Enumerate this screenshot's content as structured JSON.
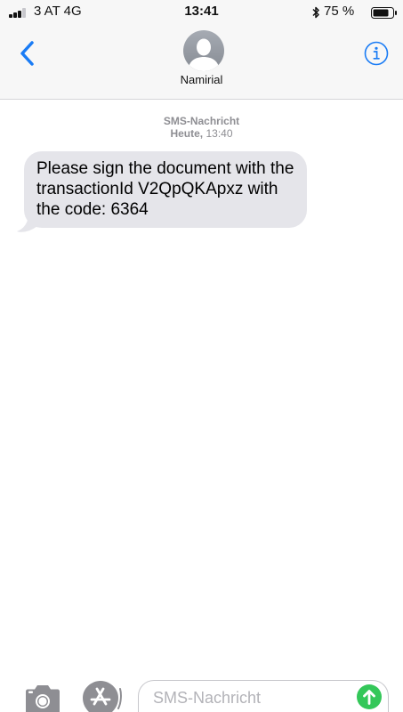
{
  "status_bar": {
    "carrier": "3 AT  4G",
    "time": "13:41",
    "battery_percent": "75 %",
    "signal_icon": "signal-bars-icon",
    "bluetooth_icon": "bluetooth-icon",
    "battery_icon": "battery-icon"
  },
  "nav": {
    "back_icon": "chevron-left-icon",
    "contact_name": "Namirial",
    "avatar_icon": "person-silhouette-icon",
    "info_icon": "info-icon"
  },
  "conversation": {
    "message_type": "SMS-Nachricht",
    "day": "Heute,",
    "time": "13:40",
    "messages": [
      {
        "direction": "incoming",
        "text": "Please sign the document with the transactionId V2QpQKApxz with the code: 6364"
      }
    ]
  },
  "input_bar": {
    "camera_icon": "camera-icon",
    "appstore_icon": "app-store-icon",
    "placeholder": "SMS-Nachricht",
    "value": "",
    "send_icon": "send-arrow-up-icon"
  },
  "colors": {
    "accent": "#1a7cf5",
    "incoming_bubble": "#e5e5ea",
    "send_button": "#34c759",
    "meta_text": "#8e8e93"
  }
}
